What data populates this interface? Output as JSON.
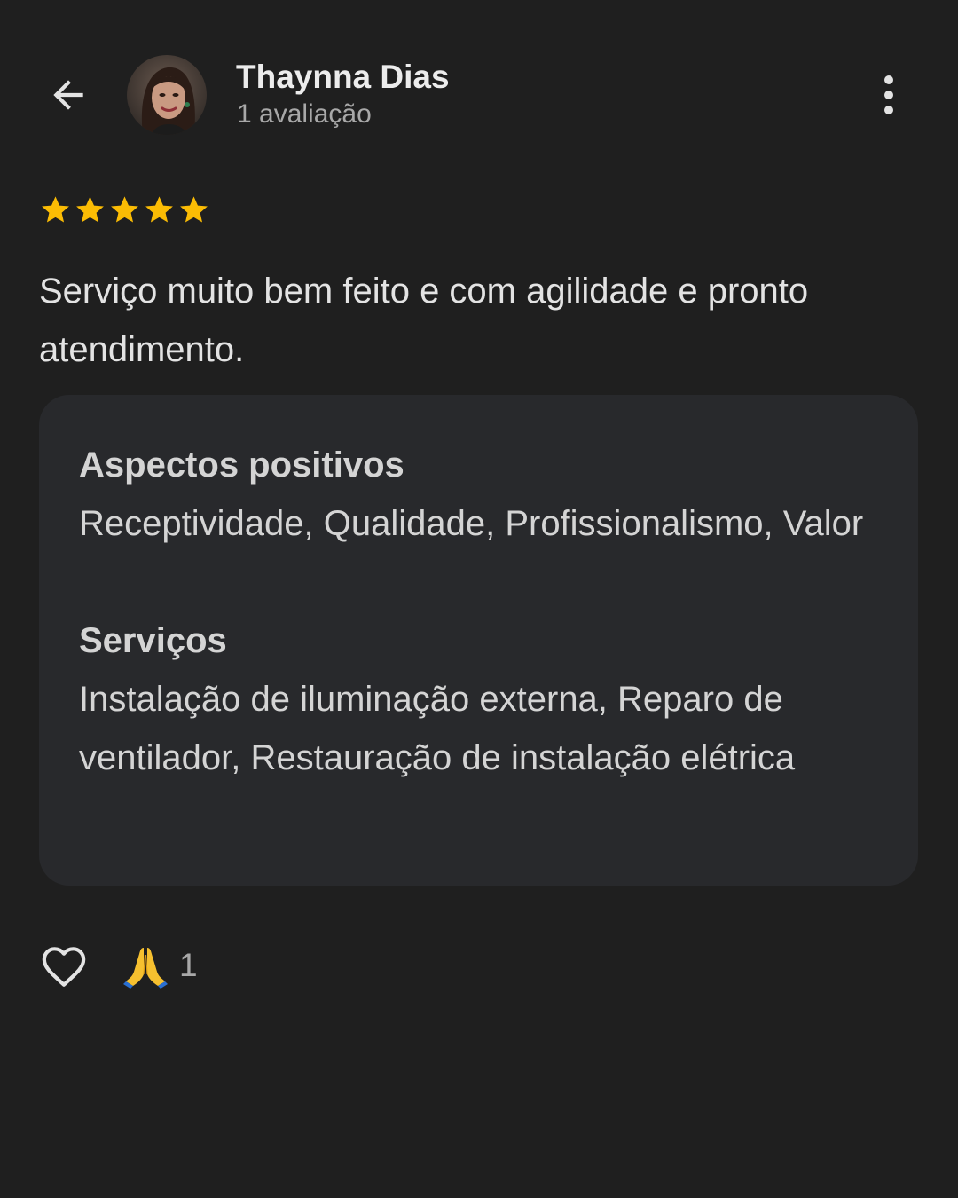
{
  "header": {
    "back_icon": "arrow-left-icon",
    "user_name": "Thaynna Dias",
    "review_count": "1 avaliação",
    "more_icon": "more-vertical-icon"
  },
  "review": {
    "rating": 5,
    "rating_max": 5,
    "star_color": "#fbbc04",
    "text": "Serviço muito bem feito e com agilidade e pronto atendimento."
  },
  "details": {
    "positive_title": "Aspectos positivos",
    "positive_text": "Receptividade, Qualidade, Profissionalismo, Valor",
    "services_title": "Serviços",
    "services_text": "Instalação de iluminação externa, Reparo de ventilador, Restauração de instalação elétrica"
  },
  "reactions": {
    "like_icon": "heart-outline-icon",
    "emoji_icon": "folded-hands-icon",
    "emoji_count": "1"
  }
}
